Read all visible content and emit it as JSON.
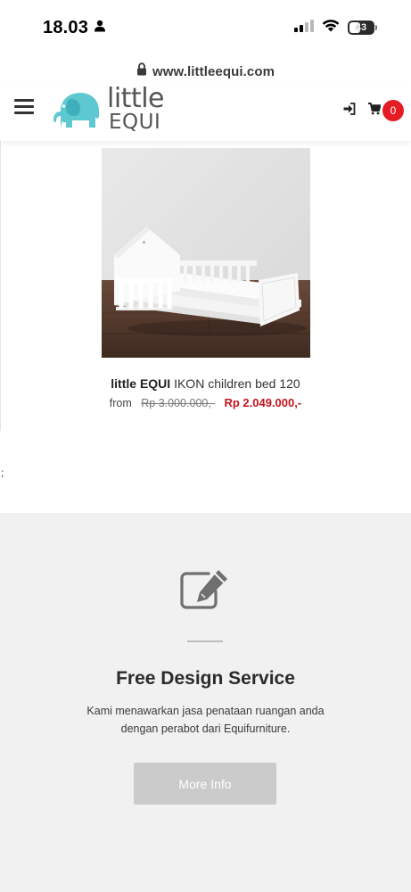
{
  "status_bar": {
    "time": "18.03",
    "battery_level": "43",
    "icons": [
      "person-icon",
      "cellular-signal-icon",
      "wifi-icon",
      "battery-icon"
    ]
  },
  "browser": {
    "url": "www.littleequi.com",
    "icons": [
      "lock-icon"
    ]
  },
  "header": {
    "logo_top": "little",
    "logo_bottom": "EQUI",
    "cart_count": "0",
    "icons": [
      "menu-icon",
      "elephant-logo-icon",
      "sign-in-icon",
      "cart-icon"
    ]
  },
  "product": {
    "brand": "little EQUI",
    "name": " IKON children bed 120",
    "price_from_label": "from",
    "old_price": "Rp 3.000.000,-",
    "new_price": "Rp 2.049.000,-"
  },
  "stray_text": ";",
  "service": {
    "title": "Free Design Service",
    "description_line1": "Kami menawarkan jasa penataan ruangan anda",
    "description_line2": "dengan perabot dari Equifurniture.",
    "button_label": "More Info",
    "icons": [
      "edit-icon"
    ]
  },
  "colors": {
    "accent_red": "#e51c24",
    "sale_price": "#c4141e",
    "logo_teal": "#5ec8d0",
    "section_bg": "#f1f1f1",
    "button_bg": "#cbcbcb"
  }
}
